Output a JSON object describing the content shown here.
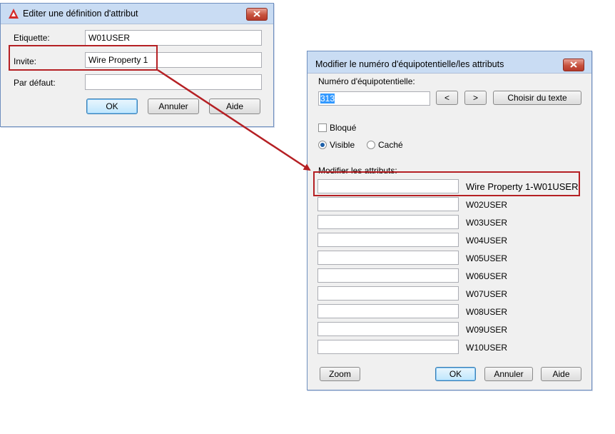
{
  "dialog1": {
    "title": "Editer une définition d'attribut",
    "label_tag": "Etiquette:",
    "value_tag": "W01USER",
    "label_prompt": "Invite:",
    "value_prompt": "Wire Property 1",
    "label_default": "Par défaut:",
    "value_default": "",
    "btn_ok": "OK",
    "btn_cancel": "Annuler",
    "btn_help": "Aide"
  },
  "dialog2": {
    "title": "Modifier le numéro d'équipotentielle/les attributs",
    "label_wire_number": "Numéro d'équipotentielle:",
    "value_wire_number": "313",
    "btn_prev": "<",
    "btn_next": ">",
    "btn_pick_text": "Choisir du texte",
    "chk_fixed": "Bloqué",
    "radio_visible": "Visible",
    "radio_hidden": "Caché",
    "visibility_selected": "Visible",
    "label_attributes": "Modifier les attributs:",
    "attributes": [
      {
        "label": "Wire Property 1-W01USER",
        "value": ""
      },
      {
        "label": "W02USER",
        "value": ""
      },
      {
        "label": "W03USER",
        "value": ""
      },
      {
        "label": "W04USER",
        "value": ""
      },
      {
        "label": "W05USER",
        "value": ""
      },
      {
        "label": "W06USER",
        "value": ""
      },
      {
        "label": "W07USER",
        "value": ""
      },
      {
        "label": "W08USER",
        "value": ""
      },
      {
        "label": "W09USER",
        "value": ""
      },
      {
        "label": "W10USER",
        "value": ""
      }
    ],
    "btn_zoom": "Zoom",
    "btn_ok": "OK",
    "btn_cancel": "Annuler",
    "btn_help": "Aide"
  },
  "colors": {
    "annotation_red": "#b52024",
    "titlebar": "#c9dcf3",
    "selection_blue": "#3399ff"
  },
  "icons": {
    "app": "autocad-logo-icon",
    "close": "close-icon",
    "annotation": "arrow-icon"
  }
}
